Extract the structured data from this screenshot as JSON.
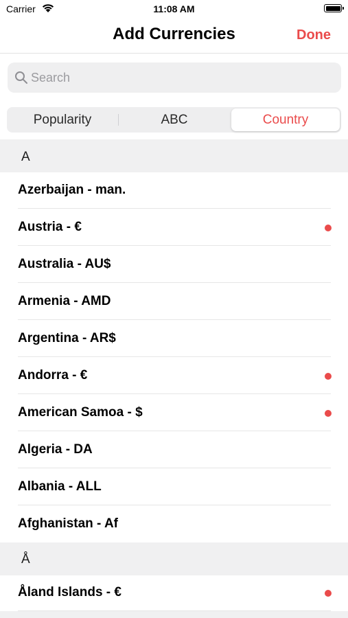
{
  "status_bar": {
    "carrier": "Carrier",
    "time": "11:08 AM"
  },
  "nav": {
    "title": "Add Currencies",
    "done_label": "Done"
  },
  "search": {
    "placeholder": "Search",
    "value": ""
  },
  "segments": [
    {
      "label": "Popularity",
      "selected": false
    },
    {
      "label": "ABC",
      "selected": false
    },
    {
      "label": "Country",
      "selected": true
    }
  ],
  "sections": [
    {
      "header": "A",
      "rows": [
        {
          "label": "Azerbaijan - man.",
          "marked": false
        },
        {
          "label": "Austria - €",
          "marked": true
        },
        {
          "label": "Australia - AU$",
          "marked": false
        },
        {
          "label": "Armenia - AMD",
          "marked": false
        },
        {
          "label": "Argentina - AR$",
          "marked": false
        },
        {
          "label": "Andorra - €",
          "marked": true
        },
        {
          "label": "American Samoa - $",
          "marked": true
        },
        {
          "label": "Algeria - DA",
          "marked": false
        },
        {
          "label": "Albania - ALL",
          "marked": false
        },
        {
          "label": "Afghanistan - Af",
          "marked": false
        }
      ]
    },
    {
      "header": "Å",
      "rows": [
        {
          "label": "Åland Islands - €",
          "marked": true
        }
      ]
    }
  ],
  "colors": {
    "accent": "#ea4b4b",
    "section_bg": "#f0f0f1",
    "search_bg": "#efeff0"
  },
  "icons": {
    "search": "search-icon",
    "wifi": "wifi-icon",
    "battery": "battery-icon",
    "marker": "red-dot-icon"
  }
}
